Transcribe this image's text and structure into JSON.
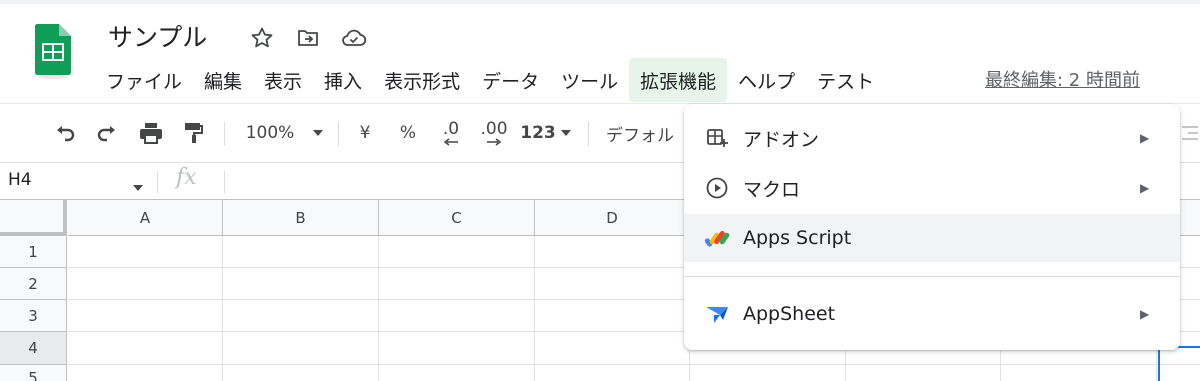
{
  "document": {
    "title": "サンプル",
    "last_edit": "最終編集: 2 時間前"
  },
  "menubar": {
    "items": [
      {
        "label": "ファイル"
      },
      {
        "label": "編集"
      },
      {
        "label": "表示"
      },
      {
        "label": "挿入"
      },
      {
        "label": "表示形式"
      },
      {
        "label": "データ"
      },
      {
        "label": "ツール"
      },
      {
        "label": "拡張機能",
        "active": true
      },
      {
        "label": "ヘルプ"
      },
      {
        "label": "テスト"
      }
    ]
  },
  "toolbar": {
    "zoom": "100%",
    "currency": "¥",
    "percent": "%",
    "decrease_decimal": ".0",
    "increase_decimal": ".00",
    "more_formats": "123",
    "font": "デフォル"
  },
  "formula_bar": {
    "name_box": "H4",
    "fx": "fx"
  },
  "grid": {
    "columns": [
      "A",
      "B",
      "C",
      "D"
    ],
    "rows": [
      "1",
      "2",
      "3",
      "4",
      "5"
    ],
    "selected_row": "4"
  },
  "dropdown": {
    "items": [
      {
        "label": "アドオン",
        "icon": "addon-icon",
        "submenu": true
      },
      {
        "label": "マクロ",
        "icon": "play-icon",
        "submenu": true
      },
      {
        "label": "Apps Script",
        "icon": "apps-script-icon",
        "submenu": false,
        "highlighted": true
      },
      {
        "label": "AppSheet",
        "icon": "appsheet-icon",
        "submenu": true
      }
    ],
    "submenu_arrow": "▶"
  },
  "colors": {
    "sheets_green": "#0f9d58",
    "menu_active_bg": "#e6f4ea",
    "selection_blue": "#1a73e8"
  }
}
